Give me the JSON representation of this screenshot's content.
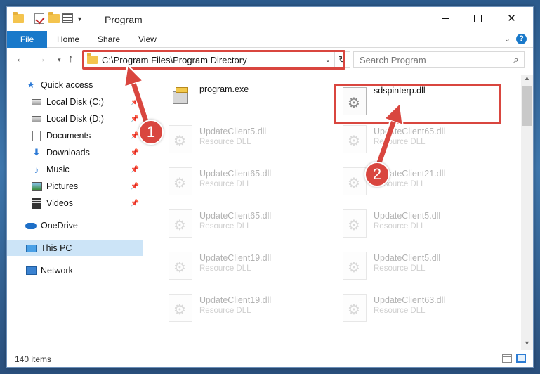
{
  "window": {
    "title": "Program"
  },
  "ribbon": {
    "tabs": [
      "File",
      "Home",
      "Share",
      "View"
    ]
  },
  "address_bar": {
    "path": "C:\\Program Files\\Program Directory",
    "search_placeholder": "Search Program"
  },
  "sidebar": {
    "items": [
      {
        "label": "Quick access",
        "icon": "quick-access-star-icon",
        "pinned": false
      },
      {
        "label": "Local Disk (C:)",
        "icon": "drive-icon",
        "pinned": true
      },
      {
        "label": "Local Disk (D:)",
        "icon": "drive-icon",
        "pinned": true
      },
      {
        "label": "Documents",
        "icon": "documents-icon",
        "pinned": true
      },
      {
        "label": "Downloads",
        "icon": "downloads-icon",
        "pinned": true
      },
      {
        "label": "Music",
        "icon": "music-icon",
        "pinned": true
      },
      {
        "label": "Pictures",
        "icon": "pictures-icon",
        "pinned": true
      },
      {
        "label": "Videos",
        "icon": "videos-icon",
        "pinned": true
      },
      {
        "label": "OneDrive",
        "icon": "onedrive-icon",
        "pinned": false
      },
      {
        "label": "This PC",
        "icon": "this-pc-icon",
        "pinned": false,
        "selected": true
      },
      {
        "label": "Network",
        "icon": "network-icon",
        "pinned": false
      }
    ]
  },
  "files": {
    "left": [
      {
        "name": "program.exe",
        "type": "",
        "icon": "exe-icon"
      },
      {
        "name": "UpdateClient5.dll",
        "type": "Resource DLL",
        "icon": "dll-icon"
      },
      {
        "name": "UpdateClient65.dll",
        "type": "Resource DLL",
        "icon": "dll-icon"
      },
      {
        "name": "UpdateClient65.dll",
        "type": "Resource DLL",
        "icon": "dll-icon"
      },
      {
        "name": "UpdateClient19.dll",
        "type": "Resource DLL",
        "icon": "dll-icon"
      },
      {
        "name": "UpdateClient19.dll",
        "type": "Resource DLL",
        "icon": "dll-icon"
      }
    ],
    "right": [
      {
        "name": "sdspinterp.dll",
        "type": "",
        "icon": "dll-icon",
        "highlighted": true
      },
      {
        "name": "UpdateClient65.dll",
        "type": "Resource DLL",
        "icon": "dll-icon"
      },
      {
        "name": "UpdateClient21.dll",
        "type": "Resource DLL",
        "icon": "dll-icon"
      },
      {
        "name": "UpdateClient5.dll",
        "type": "Resource DLL",
        "icon": "dll-icon"
      },
      {
        "name": "UpdateClient5.dll",
        "type": "Resource DLL",
        "icon": "dll-icon"
      },
      {
        "name": "UpdateClient63.dll",
        "type": "Resource DLL",
        "icon": "dll-icon"
      }
    ]
  },
  "status": {
    "item_count": "140 items"
  },
  "annotations": {
    "step1": "1",
    "step2": "2",
    "color": "#d9463f"
  }
}
